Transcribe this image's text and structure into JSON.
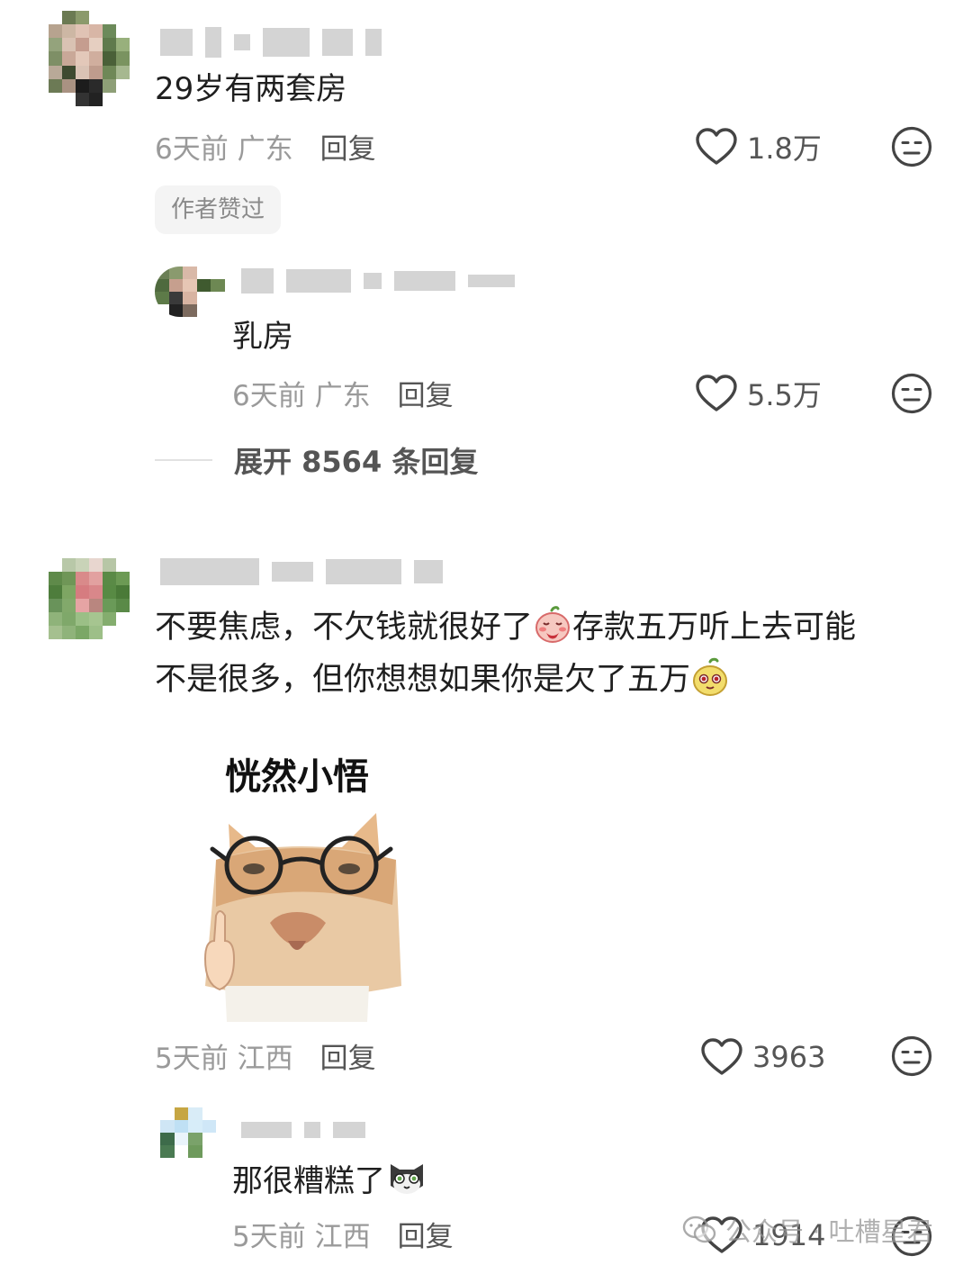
{
  "comments": [
    {
      "text": "29岁有两套房",
      "time": "6天前",
      "location": "广东",
      "reply_label": "回复",
      "likes": "1.8万",
      "badge": "作者赞过",
      "replies": [
        {
          "text": "乳房",
          "time": "6天前",
          "location": "广东",
          "reply_label": "回复",
          "likes": "5.5万"
        }
      ],
      "expand_label": "展开 8564 条回复"
    },
    {
      "text_line1a": "不要焦虑，不欠钱就很好了",
      "text_line1b": "存款五万听上去可能",
      "text_line2": "不是很多，但你想想如果你是欠了五万",
      "sticker_caption": "恍然小悟",
      "time": "5天前",
      "location": "江西",
      "reply_label": "回复",
      "likes": "3963",
      "replies": [
        {
          "text": "那很糟糕了",
          "time": "5天前",
          "location": "江西",
          "reply_label": "回复",
          "likes": "1914"
        }
      ]
    }
  ],
  "watermark": "公众号 · 吐槽星君",
  "icons": {
    "like": "heart-outline-icon",
    "dislike": "meh-face-icon",
    "watermark": "wechat-icon"
  },
  "colors": {
    "text": "#1f1f1f",
    "meta": "#9a9a9a",
    "action": "#555555",
    "badge_bg": "#f4f4f4"
  }
}
